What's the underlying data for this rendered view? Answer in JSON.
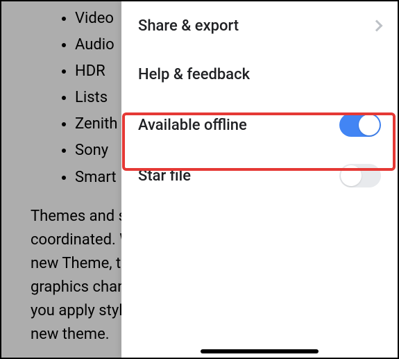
{
  "doc": {
    "bullets": [
      "Video",
      "Audio",
      "HDR",
      "Lists",
      "Zenith",
      "Sony",
      "Smart"
    ],
    "paragraph": "Themes and styles also help keep your document coordinated. When you click Design and choose a new Theme, the pictures, charts, and SmartArt graphics change to match your new theme. When you apply styles, your headings change to match the new theme."
  },
  "menu": {
    "share_export": "Share & export",
    "help_feedback": "Help & feedback",
    "available_offline": "Available offline",
    "star_file": "Star file",
    "offline_on": true,
    "star_on": false
  }
}
